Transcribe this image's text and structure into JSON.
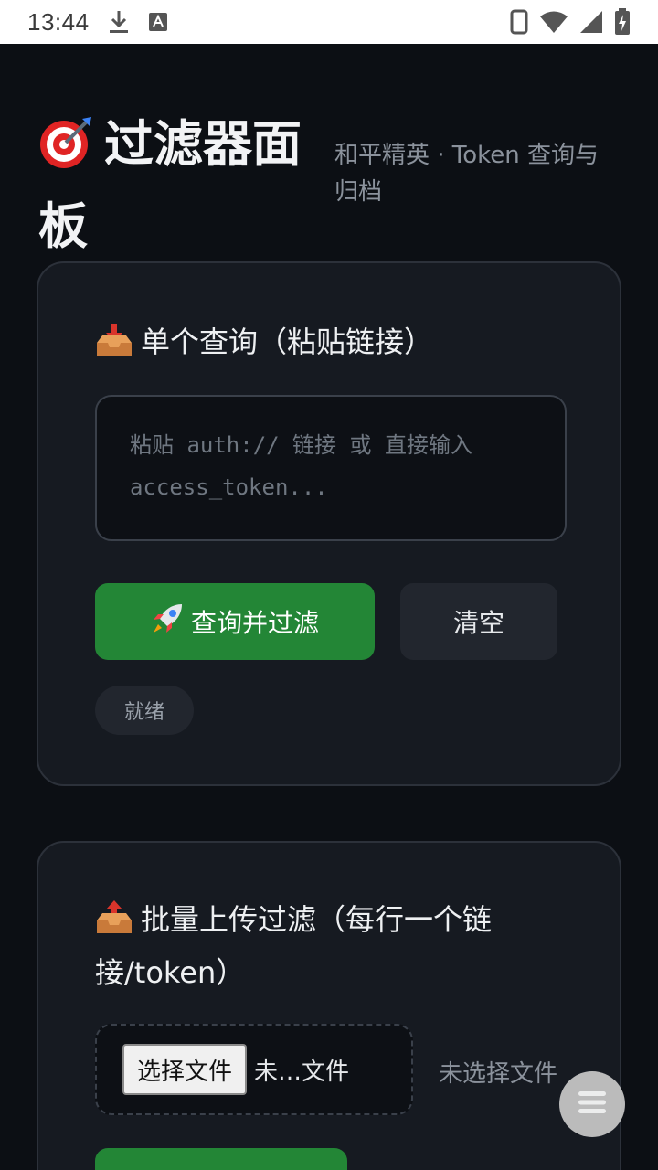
{
  "status_bar": {
    "time": "13:44"
  },
  "header": {
    "title": "过滤器面板",
    "subtitle": "和平精英 · Token 查询与归档"
  },
  "single_query": {
    "title": "单个查询（粘贴链接）",
    "placeholder": "粘贴 auth:// 链接 或 直接输入 access_token...",
    "submit_label": "查询并过滤",
    "clear_label": "清空",
    "status": "就绪"
  },
  "batch_upload": {
    "title": "批量上传过滤（每行一个链接/token）",
    "choose_file_label": "选择文件",
    "file_inline_text": "未…文件",
    "file_status": "未选择文件"
  },
  "colors": {
    "background": "#0c0f14",
    "card": "#161a21",
    "primary": "#238636",
    "secondary": "#22262e"
  }
}
